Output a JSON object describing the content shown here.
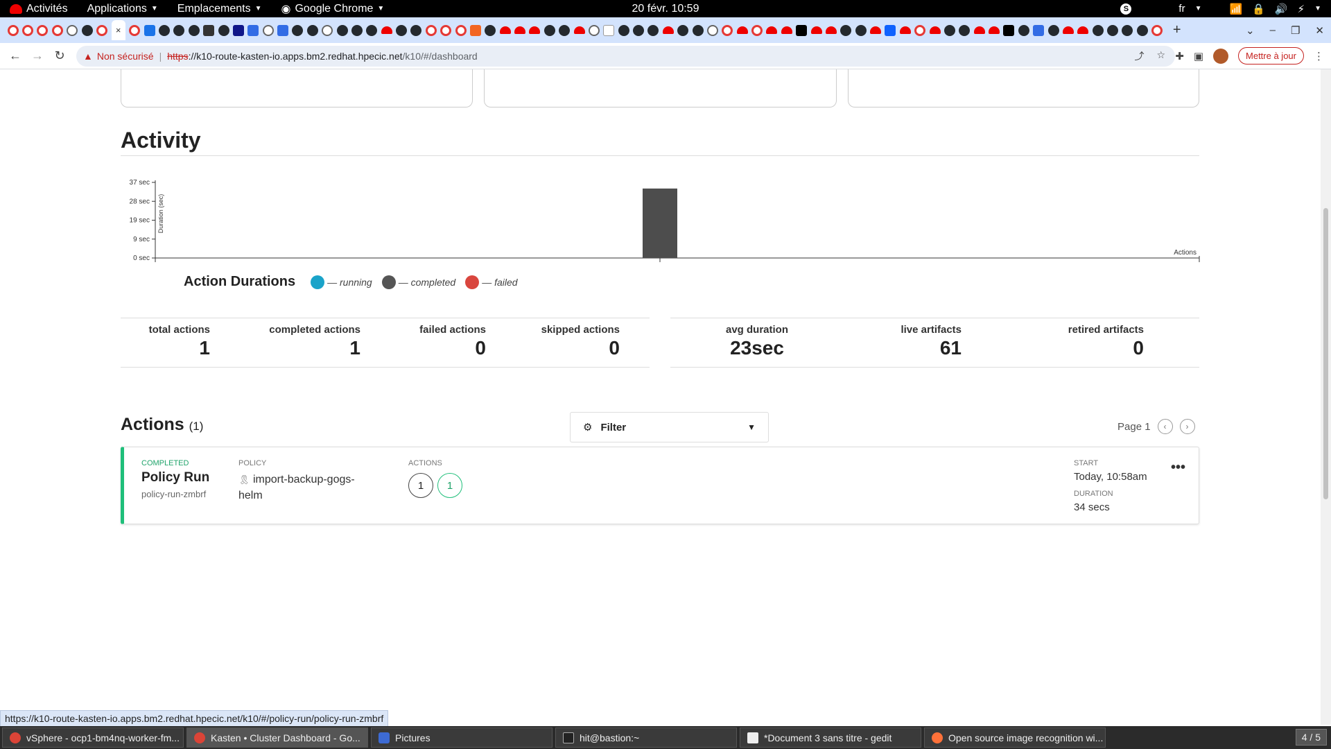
{
  "topbar": {
    "activities": "Activités",
    "applications": "Applications",
    "places": "Emplacements",
    "current_app": "Google Chrome",
    "clock": "20 févr.  10:59",
    "lang": "fr",
    "skype_badge": "S"
  },
  "browser": {
    "insecure_label": "Non sécurisé",
    "url_scheme": "https",
    "url_host": "://k10-route-kasten-io.apps.bm2.redhat.hpecic.net",
    "url_path": "/k10/#/dashboard",
    "update_button": "Mettre à jour",
    "active_tab_close": "×"
  },
  "activity": {
    "title": "Activity"
  },
  "chart_data": {
    "type": "bar",
    "title": "Action Durations",
    "ylabel": "Duration (sec)",
    "xlabel": "Actions",
    "y_ticks": [
      "0 sec",
      "9 sec",
      "19 sec",
      "28 sec",
      "37 sec"
    ],
    "ylim": [
      0,
      37
    ],
    "series": [
      {
        "name": "— completed",
        "status": "completed",
        "values": [
          34
        ]
      }
    ],
    "legend": [
      {
        "name": "— running",
        "color": "#1aa3c9"
      },
      {
        "name": "— completed",
        "color": "#555555"
      },
      {
        "name": "— failed",
        "color": "#d9463e"
      }
    ],
    "legend_placement": "bottom-left"
  },
  "stats": {
    "total_actions_label": "total actions",
    "total_actions": "1",
    "completed_actions_label": "completed actions",
    "completed_actions": "1",
    "failed_actions_label": "failed actions",
    "failed_actions": "0",
    "skipped_actions_label": "skipped actions",
    "skipped_actions": "0",
    "avg_duration_label": "avg duration",
    "avg_duration": "23sec",
    "live_artifacts_label": "live artifacts",
    "live_artifacts": "61",
    "retired_artifacts_label": "retired artifacts",
    "retired_artifacts": "0"
  },
  "actions": {
    "title": "Actions",
    "count": "(1)",
    "filter_label": "Filter",
    "page_label": "Page 1",
    "items": [
      {
        "status": "COMPLETED",
        "title": "Policy Run",
        "id": "policy-run-zmbrf",
        "policy_label": "POLICY",
        "policy": "import-backup-gogs-helm",
        "actions_label": "ACTIONS",
        "action_counts": [
          "1",
          "1"
        ],
        "start_label": "START",
        "start": "Today, 10:58am",
        "duration_label": "DURATION",
        "duration": "34 secs",
        "more": "•••"
      }
    ]
  },
  "status_url": "https://k10-route-kasten-io.apps.bm2.redhat.hpecic.net/k10/#/policy-run/policy-run-zmbrf",
  "taskbar": {
    "tasks": [
      "vSphere - ocp1-bm4nq-worker-fm...",
      "Kasten • Cluster Dashboard - Go...",
      "Pictures",
      "hit@bastion:~",
      "*Document 3 sans titre - gedit",
      "Open source image recognition wi..."
    ],
    "workspace": "4 / 5"
  }
}
